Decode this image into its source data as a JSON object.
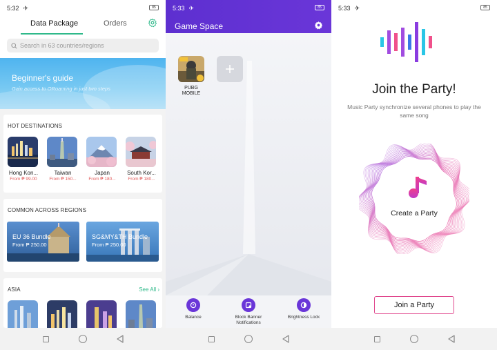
{
  "screens": [
    {
      "status": {
        "time": "5:32",
        "battery": "85"
      },
      "tabs": [
        {
          "label": "Data Package"
        },
        {
          "label": "Orders"
        }
      ],
      "search": {
        "placeholder": "Search in 63 countries/regions"
      },
      "banner": {
        "title": "Beginner's guide",
        "subtitle": "Gain access to ORoaming in just two steps"
      },
      "hot": {
        "title": "HOT DESTINATIONS",
        "items": [
          {
            "name": "Hong Kon...",
            "price": "From ₱ 99.00"
          },
          {
            "name": "Taiwan",
            "price": "From ₱ 150..."
          },
          {
            "name": "Japan",
            "price": "From ₱ 180..."
          },
          {
            "name": "South Kor...",
            "price": "From ₱ 180..."
          }
        ]
      },
      "common": {
        "title": "COMMON ACROSS REGIONS",
        "bundles": [
          {
            "name": "EU 36 Bundle",
            "price": "From ₱ 250.00"
          },
          {
            "name": "SG&MY&TH Bundle",
            "price": "From ₱ 250.00"
          }
        ]
      },
      "asia": {
        "title": "ASIA",
        "see_all": "See All ›"
      }
    },
    {
      "status": {
        "time": "5:33",
        "battery": "85"
      },
      "title": "Game Space",
      "games": [
        {
          "label": "PUBG MOBILE"
        }
      ],
      "tools": [
        {
          "label": "Balance"
        },
        {
          "label": "Block Banner Notifications"
        },
        {
          "label": "Brightness Lock"
        }
      ]
    },
    {
      "status": {
        "time": "5:33",
        "battery": "85"
      },
      "heading": "Join the Party!",
      "description": "Music Party synchronize several phones to play the same song",
      "create_label": "Create a Party",
      "join_button": "Join a Party",
      "accent": "#e0478d"
    }
  ]
}
